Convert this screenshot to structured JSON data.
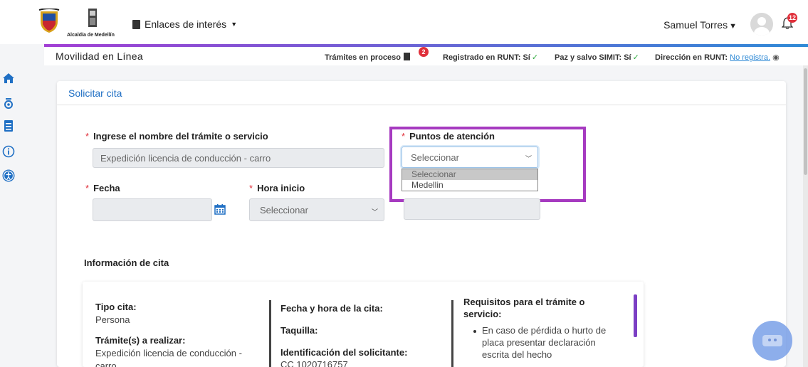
{
  "header": {
    "logo_text": "Alcaldía de Medellín",
    "links_menu": "Enlaces de interés",
    "user_name": "Samuel Torres",
    "notifications_count": "12"
  },
  "subbar": {
    "title": "Movilidad en Línea",
    "tramites_label": "Trámites en proceso",
    "tramites_count": "2",
    "runt_label": "Registrado en RUNT:",
    "runt_value": "Sí",
    "simit_label": "Paz y salvo SIMIT:",
    "simit_value": "Sí",
    "direccion_label": "Dirección en RUNT:",
    "direccion_value": "No registra."
  },
  "sidebar": {
    "icons": [
      "home-icon",
      "megaphone-icon",
      "document-icon",
      "info-icon",
      "accessibility-icon"
    ]
  },
  "form": {
    "card_title": "Solicitar cita",
    "required_mark": "*",
    "tramite_label": "Ingrese el nombre del trámite o servicio",
    "tramite_value": "Expedición licencia de conducción - carro",
    "puntos_label": "Puntos de atención",
    "puntos_value": "Seleccionar",
    "puntos_options": [
      "Seleccionar",
      "Medellin"
    ],
    "fecha_label": "Fecha",
    "fecha_value": "",
    "hora_label": "Hora inicio",
    "hora_value": "Seleccionar"
  },
  "info": {
    "title": "Información de cita",
    "tipo_cita_label": "Tipo cita:",
    "tipo_cita_value": "Persona",
    "tramite_label": "Trámite(s) a realizar:",
    "tramite_value": "Expedición licencia de conducción -",
    "tramite_value_cont": "carro",
    "fecha_hora_label": "Fecha y hora de la cita:",
    "taquilla_label": "Taquilla:",
    "identificacion_label": "Identificación del solicitante:",
    "identificacion_value": "CC 1020716757",
    "requisitos_label_1": "Requisitos para el trámite o",
    "requisitos_label_2": "servicio:",
    "requisito_1_l1": "En caso de pérdida o hurto de",
    "requisito_1_l2": "placa presentar declaración",
    "requisito_1_l3": "escrita del hecho"
  },
  "colors": {
    "accent": "#1f6fc4",
    "highlight": "#a63ac0",
    "badge": "#e0303b"
  }
}
